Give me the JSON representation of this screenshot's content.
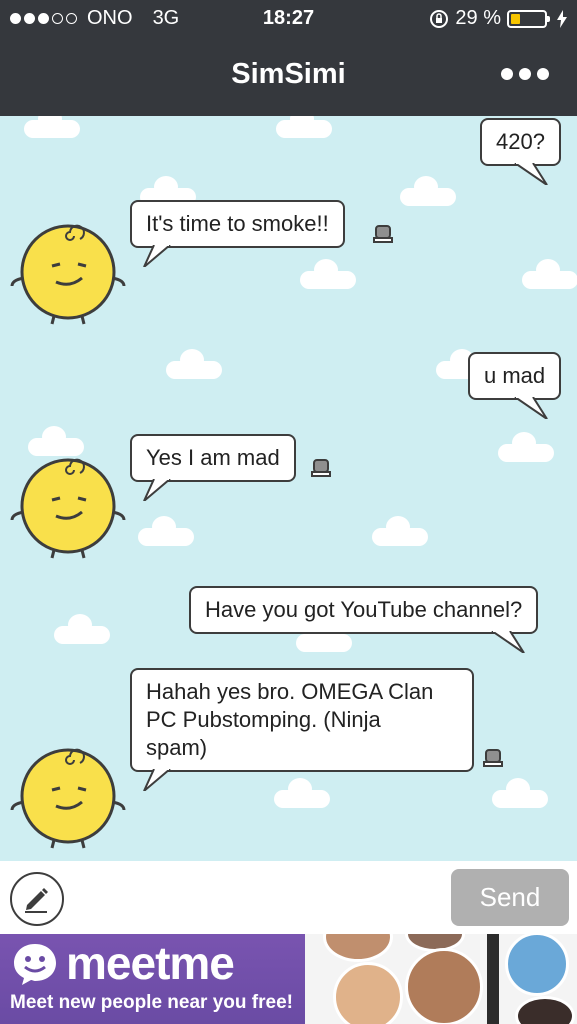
{
  "status_bar": {
    "carrier": "ONO",
    "network": "3G",
    "time": "18:27",
    "battery_percent": "29 %",
    "battery_level": 0.29,
    "signal_bars_filled": 3,
    "signal_bars_total": 5
  },
  "nav": {
    "title": "SimSimi",
    "more_icon": "ellipsis-icon"
  },
  "messages": [
    {
      "sender": "user",
      "text": "420?"
    },
    {
      "sender": "bot",
      "text": "It's time to smoke!!"
    },
    {
      "sender": "user",
      "text": "u mad"
    },
    {
      "sender": "bot",
      "text": "Yes I am mad"
    },
    {
      "sender": "user",
      "text": "Have you got YouTube channel?"
    },
    {
      "sender": "bot",
      "lines": [
        "Hahah yes bro. OMEGA Clan",
        "PC Pubstomping. (Ninja",
        "spam)"
      ]
    }
  ],
  "input_bar": {
    "pencil_icon": "pencil-icon",
    "send_label": "Send"
  },
  "ad": {
    "logo_text": "meetme",
    "tagline": "Meet new people near you free!"
  },
  "colors": {
    "nav_bg": "#35383d",
    "chat_bg": "#cfeef2",
    "avatar_yellow": "#f9e04b",
    "send_disabled": "#b0b0b0",
    "ad_purple": "#6a4ba4",
    "battery_fill": "#f7c500"
  }
}
